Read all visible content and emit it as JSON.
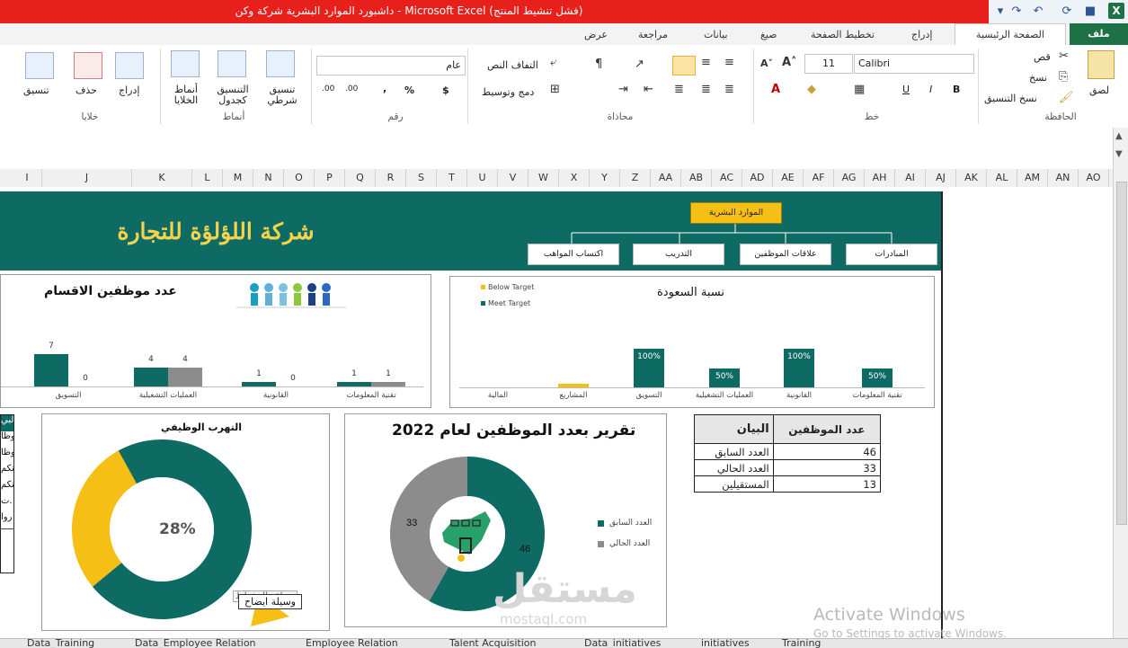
{
  "window": {
    "title": "داشبورد الموارد البشرية شركة وكن - Microsoft Excel (فشل تنشيط المنتج)"
  },
  "tabs": [
    "ملف",
    "الصفحة الرئيسية",
    "إدراج",
    "تخطيط الصفحة",
    "صيغ",
    "بيانات",
    "مراجعة",
    "عرض"
  ],
  "ribbon": {
    "clipboard": {
      "paste": "لصق",
      "cut": "قص",
      "copy": "نسخ",
      "format_painter": "نسخ التنسيق",
      "group": "الحافظة"
    },
    "font": {
      "name": "Calibri",
      "size": "11",
      "bold": "B",
      "italic": "I",
      "underline": "U",
      "group": "خط"
    },
    "alignment": {
      "wrap": "التفاف النص",
      "merge": "دمج وتوسيط",
      "group": "محاذاة"
    },
    "number": {
      "format": "عام",
      "currency": "$",
      "percent": "%",
      "comma": ",",
      "inc": ".00",
      "group": "رقم"
    },
    "styles": {
      "conditional": "تنسيق شرطي",
      "table": "التنسيق كجدول",
      "cell": "أنماط الخلايا",
      "group": "أنماط"
    },
    "cells": {
      "insert": "إدراج",
      "delete": "حذف",
      "format": "تنسيق",
      "group": "خلايا"
    }
  },
  "columns": [
    "I",
    "J",
    "K",
    "L",
    "M",
    "N",
    "O",
    "P",
    "Q",
    "R",
    "S",
    "T",
    "U",
    "V",
    "W",
    "X",
    "Y",
    "Z",
    "AA",
    "AB",
    "AC",
    "AD",
    "AE",
    "AF",
    "AG",
    "AH",
    "AI",
    "AJ",
    "AK",
    "AL",
    "AM",
    "AN",
    "AO"
  ],
  "dashboard": {
    "company": "شركة اللؤلؤة للتجارة",
    "org": {
      "root": "الموارد البشرية",
      "children": [
        "المبادرات",
        "علاقات الموظفين",
        "التدريب",
        "اكتساب المواهب"
      ]
    },
    "saudization": {
      "title": "نسبة السعودة",
      "legend_below": "Below Target",
      "legend_meet": "Meet Target",
      "colors": {
        "meet": "#0e6b63",
        "below": "#f5bf16"
      },
      "categories": [
        "تقنية المعلومات",
        "القانونية",
        "العمليات التشغيلية",
        "التسويق",
        "المشاريع",
        "المالية"
      ],
      "values": [
        "50%",
        "100%",
        "50%",
        "100%",
        "",
        ""
      ],
      "numeric": [
        50,
        100,
        50,
        100,
        10,
        0
      ]
    },
    "dept_employees": {
      "title": "عدد موظفين الاقسام",
      "categories": [
        "تقنية المعلومات",
        "القانونية",
        "العمليات التشغيلية",
        "التسويق"
      ],
      "series_a": [
        1,
        1,
        4,
        7
      ],
      "series_b": [
        1,
        0,
        4,
        0
      ],
      "colors": {
        "a": "#0e6b63",
        "b": "#8c8c8c"
      }
    },
    "turnover": {
      "title": "التهرب الوظيفي",
      "value": "28%",
      "percent": 28,
      "tooltip_top": "منطقة المخطط",
      "tooltip": "وسيلة ايضاح"
    },
    "report": {
      "title": "تقرير بعدد الموظفين لعام 2022",
      "values": [
        46,
        33
      ],
      "labels": [
        "46",
        "33"
      ],
      "legend": [
        "العدد السابق",
        "العدد الحالي"
      ]
    },
    "table": {
      "headers": [
        "البيان",
        "عدد الموظفين"
      ],
      "rows": [
        {
          "label": "العدد السابق",
          "value": "46"
        },
        {
          "label": "العدد الحالي",
          "value": "33"
        },
        {
          "label": "المستقيلين",
          "value": "13"
        }
      ]
    },
    "left_cut": [
      "البي",
      "وظا",
      "وظا",
      "تكم",
      "تكم",
      "ت.",
      "روا"
    ]
  },
  "sheet_tabs": [
    "Data_Training",
    "Data_Employee Relation",
    "Employee Relation",
    "Talent Acquisition",
    "Data_initiatives",
    "initiatives",
    "Training"
  ],
  "watermark": {
    "activate": "Activate Windows",
    "activate_sub": "Go to Settings to activate Windows.",
    "brand": "مستقل",
    "brand_sub": "mostaql.com"
  }
}
